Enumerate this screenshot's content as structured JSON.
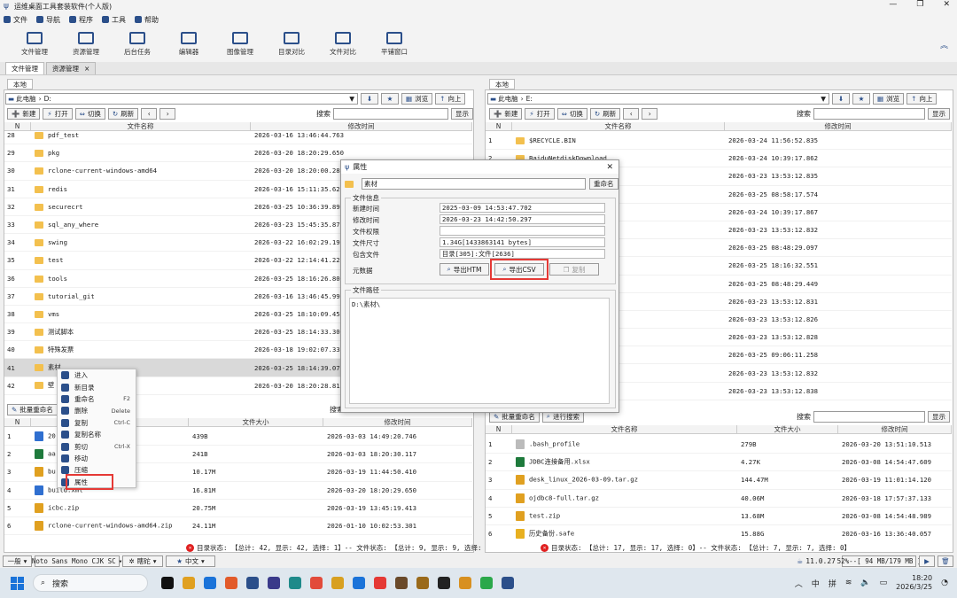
{
  "window": {
    "title": "运维桌面工具套装软件(个人版)"
  },
  "menu": [
    {
      "label": "文件",
      "icon": "file-icon"
    },
    {
      "label": "导航",
      "icon": "list-icon"
    },
    {
      "label": "程序",
      "icon": "window-icon"
    },
    {
      "label": "工具",
      "icon": "toolbox-icon"
    },
    {
      "label": "帮助",
      "icon": "help-icon"
    }
  ],
  "toolbar": [
    {
      "label": "文件管理",
      "icon": "folder-open-icon"
    },
    {
      "label": "资源管理",
      "icon": "satellite-icon"
    },
    {
      "label": "后台任务",
      "icon": "monitor-icon"
    },
    {
      "label": "编辑器",
      "icon": "edit-icon"
    },
    {
      "label": "图像管理",
      "icon": "image-icon"
    },
    {
      "label": "目录对比",
      "icon": "copy-icon"
    },
    {
      "label": "文件对比",
      "icon": "file-compare-icon"
    },
    {
      "label": "平铺窗口",
      "icon": "tile-window-icon"
    }
  ],
  "tabs": [
    {
      "label": "文件管理"
    },
    {
      "label": "资源管理",
      "close": "×"
    }
  ],
  "labels": {
    "local": "本地",
    "thispc": "此电脑",
    "browse": "浏览",
    "up": "向上",
    "new": "新建",
    "open": "打开",
    "switch": "切换",
    "refresh": "刷新",
    "search": "搜索",
    "show": "显示",
    "col_n": "N",
    "col_name": "文件名称",
    "col_mtime": "修改时间",
    "col_size": "文件大小",
    "batch_rename": "批量重命名",
    "search_in": "进行搜索"
  },
  "left": {
    "path": "D:",
    "dirs": [
      {
        "n": "28",
        "name": "pdf_test",
        "time": "2026-03-16 13:46:44.763"
      },
      {
        "n": "29",
        "name": "pkg",
        "time": "2026-03-20 18:20:29.650"
      },
      {
        "n": "30",
        "name": "rclone-current-windows-amd64",
        "time": "2026-03-20 18:20:00.286"
      },
      {
        "n": "31",
        "name": "redis",
        "time": "2026-03-16 15:11:35.626"
      },
      {
        "n": "32",
        "name": "securecrt",
        "time": "2026-03-25 10:36:39.899"
      },
      {
        "n": "33",
        "name": "sql_any_where",
        "time": "2026-03-23 15:45:35.876"
      },
      {
        "n": "34",
        "name": "swing",
        "time": "2026-03-22 16:02:29.199"
      },
      {
        "n": "35",
        "name": "test",
        "time": "2026-03-22 12:14:41.227"
      },
      {
        "n": "36",
        "name": "tools",
        "time": "2026-03-25 18:16:26.808"
      },
      {
        "n": "37",
        "name": "tutorial_git",
        "time": "2026-03-16 13:46:45.996"
      },
      {
        "n": "38",
        "name": "vms",
        "time": "2026-03-25 18:10:09.458"
      },
      {
        "n": "39",
        "name": "测试脚本",
        "time": "2026-03-25 18:14:33.304"
      },
      {
        "n": "40",
        "name": "特殊发票",
        "time": "2026-03-18 19:02:07.333"
      },
      {
        "n": "41",
        "name": "素材",
        "time": "2026-03-25 18:14:39.079"
      },
      {
        "n": "42",
        "name": "壁",
        "time": "2026-03-20 18:20:28.819"
      }
    ],
    "files": [
      {
        "n": "1",
        "name": "20",
        "size": "439B",
        "time": "2026-03-03 14:49:20.746",
        "icon": "document-icon",
        "color": "#2f6fd0"
      },
      {
        "n": "2",
        "name": "aa",
        "size": "241B",
        "time": "2026-03-03 18:20:30.117",
        "icon": "excel-icon",
        "color": "#1e7a3c"
      },
      {
        "n": "3",
        "name": "bu",
        "size": "10.17M",
        "time": "2026-03-19 11:44:50.410",
        "icon": "archive-icon",
        "color": "#e0a020"
      },
      {
        "n": "4",
        "name": "build.xml",
        "size": "16.81M",
        "time": "2026-03-20 18:20:29.650",
        "icon": "document-icon",
        "color": "#2f6fd0"
      },
      {
        "n": "5",
        "name": "icbc.zip",
        "size": "20.75M",
        "time": "2026-03-19 13:45:19.413",
        "icon": "archive-icon",
        "color": "#e0a020"
      },
      {
        "n": "6",
        "name": "rclone-current-windows-amd64.zip",
        "size": "24.11M",
        "time": "2026-01-10 10:02:53.301",
        "icon": "archive-icon",
        "color": "#e0a020"
      }
    ],
    "status": "目录状态: 【总计: 42, 显示: 42, 选择: 1】-- 文件状态: 【总计: 9, 显示: 9, 选择: 0】"
  },
  "right": {
    "path": "E:",
    "dirs": [
      {
        "n": "1",
        "name": "$RECYCLE.BIN",
        "time": "2026-03-24 11:56:52.835"
      },
      {
        "n": "2",
        "name": "BaiduNetdiskDownload",
        "time": "2026-03-24 10:39:17.862"
      },
      {
        "n": "3",
        "name": "",
        "time": "2026-03-23 13:53:12.835"
      },
      {
        "n": "4",
        "name": "",
        "time": "2026-03-25 08:58:17.574"
      },
      {
        "n": "5",
        "name": "",
        "time": "2026-03-24 10:39:17.867"
      },
      {
        "n": "6",
        "name": "",
        "time": "2026-03-23 13:53:12.832"
      },
      {
        "n": "7",
        "name": "",
        "time": "2026-03-25 08:48:29.097"
      },
      {
        "n": "8",
        "name": "",
        "time": "2026-03-25 18:16:32.551"
      },
      {
        "n": "9",
        "name": "",
        "time": "2026-03-25 08:48:29.449"
      },
      {
        "n": "10",
        "name": "",
        "time": "2026-03-23 13:53:12.831"
      },
      {
        "n": "11",
        "name": "",
        "time": "2026-03-23 13:53:12.826"
      },
      {
        "n": "12",
        "name": "",
        "time": "2026-03-23 13:53:12.828"
      },
      {
        "n": "13",
        "name": "",
        "time": "2026-03-25 09:06:11.258"
      },
      {
        "n": "14",
        "name": "",
        "time": "2026-03-23 13:53:12.832"
      },
      {
        "n": "15",
        "name": "",
        "time": "2026-03-23 13:53:12.838"
      }
    ],
    "files": [
      {
        "n": "1",
        "name": ".bash_profile",
        "size": "279B",
        "time": "2026-03-20 13:51:10.513",
        "icon": "blank-file-icon",
        "color": "#bbbbbb"
      },
      {
        "n": "2",
        "name": "JDBC连接备用.xlsx",
        "size": "4.27K",
        "time": "2026-03-08 14:54:47.609",
        "icon": "excel-icon",
        "color": "#1e7a3c"
      },
      {
        "n": "3",
        "name": "desk_linux_2026-03-09.tar.gz",
        "size": "144.47M",
        "time": "2026-03-19 11:01:14.120",
        "icon": "archive-icon",
        "color": "#e0a020"
      },
      {
        "n": "4",
        "name": "ojdbc8-full.tar.gz",
        "size": "40.06M",
        "time": "2026-03-18 17:57:37.133",
        "icon": "archive-icon",
        "color": "#e0a020"
      },
      {
        "n": "5",
        "name": "test.zip",
        "size": "13.68M",
        "time": "2026-03-08 14:54:48.989",
        "icon": "archive-icon",
        "color": "#e0a020"
      },
      {
        "n": "6",
        "name": "历史备份.safe",
        "size": "15.88G",
        "time": "2026-03-16 13:36:40.057",
        "icon": "shield-icon",
        "color": "#e8b020"
      }
    ],
    "status": "目录状态: 【总计: 17, 显示: 17, 选择: 0】-- 文件状态: 【总计: 7, 显示: 7, 选择: 0】"
  },
  "dialog": {
    "title": "属性",
    "name": "素材",
    "rename": "重命名",
    "info_title": "文件信息",
    "path_title": "文件路径",
    "fields": [
      {
        "label": "新建时间",
        "value": "2025-03-09 14:53:47.702"
      },
      {
        "label": "修改时间",
        "value": "2026-03-23 14:42:50.297"
      },
      {
        "label": "文件权限",
        "value": ""
      },
      {
        "label": "文件尺寸",
        "value": "1.34G[1433863141 bytes]"
      },
      {
        "label": "包含文件",
        "value": "目录[305]:文件[2636]"
      }
    ],
    "meta_label": "元数据",
    "export_htm": "导出HTM",
    "export_csv": "导出CSV",
    "copy": "复制",
    "path": "D:\\素材\\",
    "close": "✕"
  },
  "context_menu": [
    {
      "label": "进入",
      "key": "",
      "icon": "enter-icon"
    },
    {
      "label": "新目录",
      "key": "",
      "icon": "new-folder-icon"
    },
    {
      "label": "重命名",
      "key": "F2",
      "icon": "rename-icon"
    },
    {
      "label": "删除",
      "key": "Delete",
      "icon": "delete-icon"
    },
    {
      "label": "复制",
      "key": "Ctrl-C",
      "icon": "copy-icon"
    },
    {
      "label": "复制名称",
      "key": "",
      "icon": "copy-name-icon"
    },
    {
      "label": "剪切",
      "key": "Ctrl-X",
      "icon": "cut-icon"
    },
    {
      "label": "移动",
      "key": "",
      "icon": "move-icon"
    },
    {
      "label": "压缩",
      "key": "",
      "icon": "compress-icon"
    },
    {
      "label": "属性",
      "key": "",
      "icon": "properties-icon"
    }
  ],
  "bottombar": {
    "mode": "一般",
    "font": "Noto Sans Mono CJK SC",
    "theme": "瞎砣",
    "lang": "中文",
    "version": "11.0.27",
    "mem": "52%--[ 94 MB/179 MB ]"
  },
  "taskbar": {
    "search": "搜索",
    "ime1": "中",
    "ime2": "拼",
    "time": "18:20",
    "date": "2026/3/25"
  },
  "colors": {
    "accent": "#2b4f8a",
    "highlight": "#e53935",
    "folder": "#f3c04e"
  }
}
